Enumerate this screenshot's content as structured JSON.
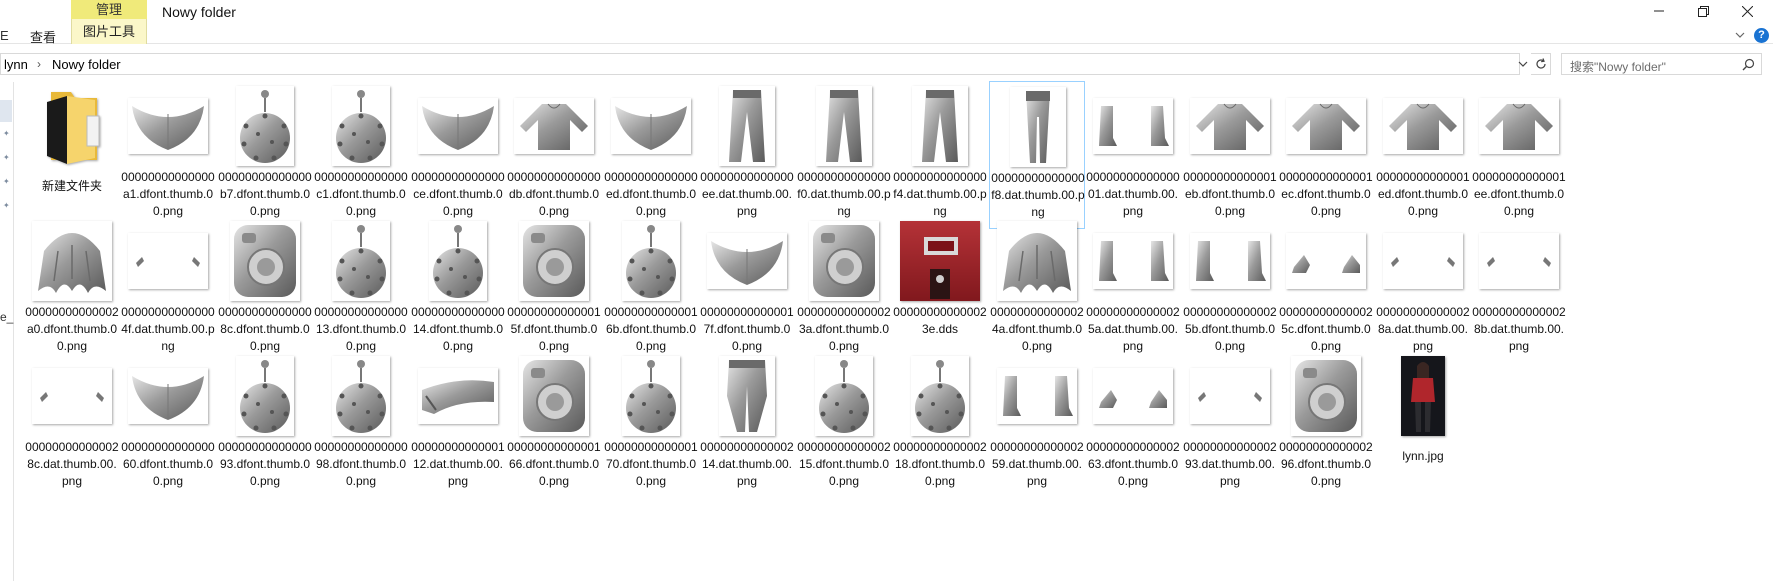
{
  "ribbon": {
    "tab_stub": "E",
    "tab_view": "查看",
    "context_group": "管理",
    "context_tab": "图片工具"
  },
  "window": {
    "title": "Nowy folder"
  },
  "address": {
    "crumb1": "lynn",
    "crumb2": "Nowy folder"
  },
  "search": {
    "placeholder": "搜索\"Nowy folder\""
  },
  "nav": {
    "truncated_label": "e_"
  },
  "colors": {
    "selection_border": "#99d1ff",
    "context_tab_head": "#f0ea7a",
    "help_icon": "#1a73d2"
  },
  "files": [
    {
      "name": "新建文件夹",
      "icon": "folder-icon"
    },
    {
      "name": "00000000000000a1.dfont.thumb.00.png",
      "icon": "mask-thumbnail"
    },
    {
      "name": "00000000000000b7.dfont.thumb.00.png",
      "icon": "spiky-ball-thumbnail"
    },
    {
      "name": "00000000000000c1.dfont.thumb.00.png",
      "icon": "spiky-ball-thumbnail"
    },
    {
      "name": "00000000000000ce.dfont.thumb.00.png",
      "icon": "mask-thumbnail"
    },
    {
      "name": "00000000000000db.dfont.thumb.00.png",
      "icon": "shirt-thumbnail"
    },
    {
      "name": "00000000000000ed.dfont.thumb.00.png",
      "icon": "mask-thumbnail"
    },
    {
      "name": "00000000000000ee.dat.thumb.00.png",
      "icon": "pants-thumbnail"
    },
    {
      "name": "00000000000000f0.dat.thumb.00.png",
      "icon": "pants-thumbnail"
    },
    {
      "name": "00000000000000f4.dat.thumb.00.png",
      "icon": "pants-thumbnail"
    },
    {
      "name": "00000000000000f8.dat.thumb.00.png",
      "icon": "legs-thumbnail",
      "selected": true
    },
    {
      "name": "0000000000000001.dat.thumb.00.png",
      "icon": "boots-thumbnail"
    },
    {
      "name": "00000000000001eb.dfont.thumb.00.png",
      "icon": "shirt-thumbnail"
    },
    {
      "name": "00000000000001ec.dfont.thumb.00.png",
      "icon": "shirt-thumbnail"
    },
    {
      "name": "00000000000001ed.dfont.thumb.00.png",
      "icon": "shirt-thumbnail"
    },
    {
      "name": "00000000000001ee.dfont.thumb.00.png",
      "icon": "shirt-thumbnail"
    },
    {
      "name": "00000000000002a0.dfont.thumb.00.png",
      "icon": "hair-thumbnail"
    },
    {
      "name": "000000000000004f.dat.thumb.00.png",
      "icon": "tiny-pair-thumbnail"
    },
    {
      "name": "000000000000008c.dfont.thumb.00.png",
      "icon": "camera-thumbnail"
    },
    {
      "name": "0000000000000013.dfont.thumb.00.png",
      "icon": "spiky-ball-thumbnail"
    },
    {
      "name": "0000000000000014.dfont.thumb.00.png",
      "icon": "spiky-ball-thumbnail"
    },
    {
      "name": "000000000000015f.dfont.thumb.00.png",
      "icon": "camera-thumbnail"
    },
    {
      "name": "000000000000016b.dfont.thumb.00.png",
      "icon": "spiky-ball-thumbnail"
    },
    {
      "name": "000000000000017f.dfont.thumb.00.png",
      "icon": "mask-thumbnail"
    },
    {
      "name": "000000000000023a.dfont.thumb.00.png",
      "icon": "camera-thumbnail"
    },
    {
      "name": "000000000000023e.dds",
      "icon": "dds-texture-thumbnail"
    },
    {
      "name": "000000000000024a.dfont.thumb.00.png",
      "icon": "hair-thumbnail"
    },
    {
      "name": "000000000000025a.dat.thumb.00.png",
      "icon": "boots-thumbnail"
    },
    {
      "name": "000000000000025b.dfont.thumb.00.png",
      "icon": "boots-thumbnail"
    },
    {
      "name": "000000000000025c.dfont.thumb.00.png",
      "icon": "shoes-thumbnail"
    },
    {
      "name": "000000000000028a.dat.thumb.00.png",
      "icon": "tiny-pair-thumbnail"
    },
    {
      "name": "000000000000028b.dat.thumb.00.png",
      "icon": "tiny-pair-thumbnail"
    },
    {
      "name": "000000000000028c.dat.thumb.00.png",
      "icon": "tiny-pair-thumbnail"
    },
    {
      "name": "0000000000000060.dfont.thumb.00.png",
      "icon": "mask-thumbnail"
    },
    {
      "name": "0000000000000093.dfont.thumb.00.png",
      "icon": "spiky-ball-thumbnail"
    },
    {
      "name": "0000000000000098.dfont.thumb.00.png",
      "icon": "spiky-ball-thumbnail"
    },
    {
      "name": "0000000000000112.dat.thumb.00.png",
      "icon": "visor-thumbnail"
    },
    {
      "name": "0000000000000166.dfont.thumb.00.png",
      "icon": "camera-thumbnail"
    },
    {
      "name": "0000000000000170.dfont.thumb.00.png",
      "icon": "spiky-ball-thumbnail"
    },
    {
      "name": "0000000000000214.dat.thumb.00.png",
      "icon": "shorts-thumbnail"
    },
    {
      "name": "0000000000000215.dfont.thumb.00.png",
      "icon": "spiky-ball-thumbnail"
    },
    {
      "name": "0000000000000218.dfont.thumb.00.png",
      "icon": "spiky-ball-thumbnail"
    },
    {
      "name": "0000000000000259.dat.thumb.00.png",
      "icon": "boots-thumbnail"
    },
    {
      "name": "0000000000000263.dfont.thumb.00.png",
      "icon": "shoes-thumbnail"
    },
    {
      "name": "0000000000000293.dat.thumb.00.png",
      "icon": "tiny-pair-thumbnail"
    },
    {
      "name": "0000000000000296.dfont.thumb.00.png",
      "icon": "camera-thumbnail"
    },
    {
      "name": "lynn.jpg",
      "icon": "photo-thumbnail"
    }
  ]
}
